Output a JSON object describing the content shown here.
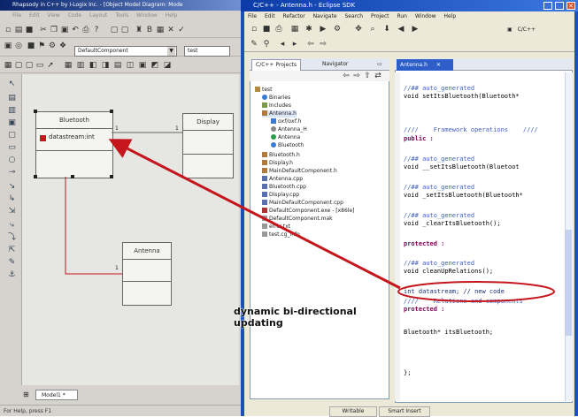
{
  "rhapsody": {
    "title": "Rhapsody in C++ by I-Logix Inc. - [Object Model Diagram: Mode",
    "menu": [
      "File",
      "Edit",
      "View",
      "Code",
      "Layout",
      "Tools",
      "Window",
      "Help"
    ],
    "component_combo": "DefaultComponent",
    "config_combo": "test",
    "classes": {
      "bluetooth": {
        "name": "Bluetooth",
        "attribute": "datastream:int"
      },
      "display": {
        "name": "Display"
      },
      "antenna": {
        "name": "Antenna"
      }
    },
    "multiplicities": [
      "1",
      "1",
      "1"
    ],
    "model_tab": "Model1 *",
    "status": "For Help, press F1"
  },
  "eclipse": {
    "title": "C/C++ - Antenna.h - Eclipse SDK",
    "menu": [
      "File",
      "Edit",
      "Refactor",
      "Navigate",
      "Search",
      "Project",
      "Run",
      "Window",
      "Help"
    ],
    "perspective": "C/C++",
    "projects_tab": "C/C++ Projects",
    "navigator_tab": "Navigator",
    "tree": [
      "test",
      "Binaries",
      "Includes",
      "Antenna.h",
      "oxf/oxf.h",
      "Antenna_H",
      "Antenna",
      "Bluetooth",
      "Bluetooth.h",
      "Display.h",
      "MainDefaultComponent.h",
      "Antenna.cpp",
      "Bluetooth.cpp",
      "Display.cpp",
      "MainDefaultComponent.cpp",
      "DefaultComponent.exe - [x86le]",
      "DefaultComponent.mak",
      "error.txt",
      "test.cg_info"
    ],
    "editor_tab": "Antenna.h",
    "code": [
      "//## auto_generated",
      "void setItsBluetooth(Bluetooth*",
      "////    Framework operations    ////",
      "public :",
      "//## auto_generated",
      "void __setItsBluetooth(Bluetoot",
      "//## auto_generated",
      "void _setItsBluetooth(Bluetooth*",
      "//## auto_generated",
      "void _clearItsBluetooth();",
      "protected :",
      "//## auto_generated",
      "void cleanUpRelations();",
      "int datastream; // new code",
      "////    Relations and components",
      "protected :",
      "Bluetooth* itsBluetooth;",
      "};"
    ],
    "status": [
      "Writable",
      "Smart Insert"
    ]
  },
  "annotation": "dynamic bi-directional updating",
  "colors": {
    "arrow": "#c4161c",
    "eclipse_frame": "#1d4fb8",
    "highlight": "#c4161c"
  }
}
